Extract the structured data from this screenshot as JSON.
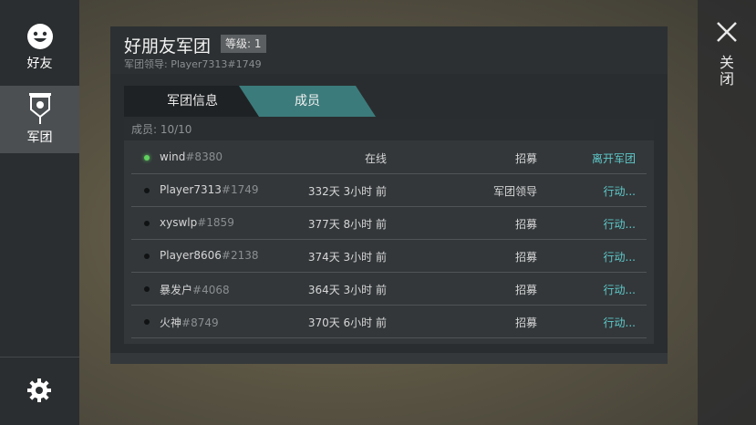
{
  "sidebar": {
    "friends_label": "好友",
    "legion_label": "军团",
    "friends_icon": "smiley-face-icon",
    "legion_icon": "legion-banner-icon",
    "settings_icon": "gear-icon"
  },
  "closebar": {
    "close_label": "关闭",
    "close_icon": "close-x-icon"
  },
  "panel": {
    "title": "好朋友军团",
    "level": "等级: 1",
    "leader": "军团领导: Player7313#1749",
    "tabs": [
      {
        "label": "军团信息",
        "active": false
      },
      {
        "label": "成员",
        "active": true
      }
    ],
    "member_count": "成员: 10/10",
    "members": [
      {
        "name": "wind",
        "tag": "#8380",
        "status": "在线",
        "role": "招募",
        "action": "离开军团",
        "online": true
      },
      {
        "name": "Player7313",
        "tag": "#1749",
        "status": "332天 3小时 前",
        "role": "军团领导",
        "action": "行动...",
        "online": false
      },
      {
        "name": "xyswlp",
        "tag": "#1859",
        "status": "377天 8小时 前",
        "role": "招募",
        "action": "行动...",
        "online": false
      },
      {
        "name": "Player8606",
        "tag": "#2138",
        "status": "374天 3小时 前",
        "role": "招募",
        "action": "行动...",
        "online": false
      },
      {
        "name": "暴发户",
        "tag": "#4068",
        "status": "364天 3小时 前",
        "role": "招募",
        "action": "行动...",
        "online": false
      },
      {
        "name": "火神",
        "tag": "#8749",
        "status": "370天 6小时 前",
        "role": "招募",
        "action": "行动...",
        "online": false
      }
    ]
  },
  "colors": {
    "accent": "#3c7b7b",
    "link": "#5ec9c9",
    "online": "#5fd15f"
  }
}
